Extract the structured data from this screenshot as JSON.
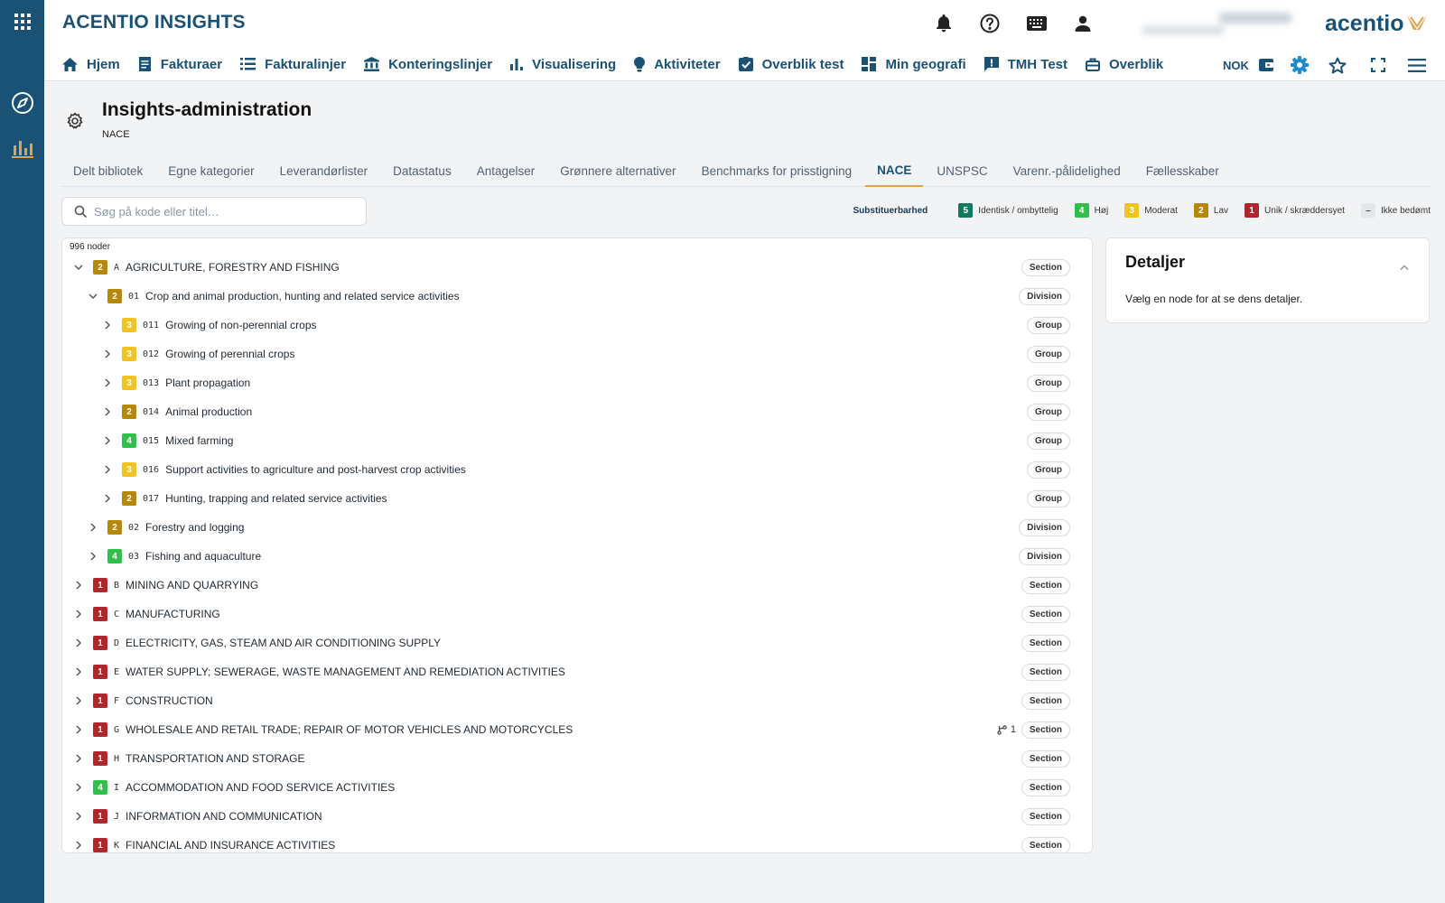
{
  "app": {
    "title": "ACENTIO INSIGHTS",
    "logo_text": "acentio"
  },
  "header": {
    "currency": "NOK"
  },
  "nav": [
    {
      "label": "Hjem",
      "icon": "home-icon"
    },
    {
      "label": "Fakturaer",
      "icon": "document-icon"
    },
    {
      "label": "Fakturalinjer",
      "icon": "list-icon"
    },
    {
      "label": "Konteringslinjer",
      "icon": "bank-icon"
    },
    {
      "label": "Visualisering",
      "icon": "bar-chart-icon"
    },
    {
      "label": "Aktiviteter",
      "icon": "lightbulb-icon"
    },
    {
      "label": "Overblik test",
      "icon": "checkbox-icon"
    },
    {
      "label": "Min geografi",
      "icon": "dashboard-icon"
    },
    {
      "label": "TMH Test",
      "icon": "feedback-icon"
    },
    {
      "label": "Overblik",
      "icon": "briefcase-icon"
    }
  ],
  "page": {
    "title": "Insights-administration",
    "subtitle": "NACE"
  },
  "tabs": [
    {
      "label": "Delt bibliotek"
    },
    {
      "label": "Egne kategorier"
    },
    {
      "label": "Leverandørlister"
    },
    {
      "label": "Datastatus"
    },
    {
      "label": "Antagelser"
    },
    {
      "label": "Grønnere alternativer"
    },
    {
      "label": "Benchmarks for prisstigning"
    },
    {
      "label": "NACE",
      "active": true
    },
    {
      "label": "UNSPSC"
    },
    {
      "label": "Varenr.-pålidelighed"
    },
    {
      "label": "Fællesskaber"
    }
  ],
  "search": {
    "placeholder": "Søg på kode eller titel…",
    "value": ""
  },
  "legend": {
    "title": "Substituerbarhed",
    "items": [
      {
        "level": "5",
        "label": "Identisk / ombyttelig",
        "color": "#0f7a5e"
      },
      {
        "level": "4",
        "label": "Høj",
        "color": "#2fbf4a"
      },
      {
        "level": "3",
        "label": "Moderat",
        "color": "#f2c423"
      },
      {
        "level": "2",
        "label": "Lav",
        "color": "#b8860b"
      },
      {
        "level": "1",
        "label": "Unik / skræddersyet",
        "color": "#b0242b"
      },
      {
        "level": "–",
        "label": "Ikke bedømt",
        "color": "#e3e6ea"
      }
    ]
  },
  "tree": {
    "count_label": "996 noder",
    "rows": [
      {
        "depth": 0,
        "expanded": true,
        "level": "2",
        "code": "A",
        "label": "AGRICULTURE, FORESTRY AND FISHING",
        "type": "Section"
      },
      {
        "depth": 1,
        "expanded": true,
        "level": "2",
        "code": "01",
        "label": "Crop and animal production, hunting and related service activities",
        "type": "Division"
      },
      {
        "depth": 2,
        "expanded": false,
        "level": "3",
        "code": "011",
        "label": "Growing of non-perennial crops",
        "type": "Group"
      },
      {
        "depth": 2,
        "expanded": false,
        "level": "3",
        "code": "012",
        "label": "Growing of perennial crops",
        "type": "Group"
      },
      {
        "depth": 2,
        "expanded": false,
        "level": "3",
        "code": "013",
        "label": "Plant propagation",
        "type": "Group"
      },
      {
        "depth": 2,
        "expanded": false,
        "level": "2",
        "code": "014",
        "label": "Animal production",
        "type": "Group"
      },
      {
        "depth": 2,
        "expanded": false,
        "level": "4",
        "code": "015",
        "label": "Mixed farming",
        "type": "Group"
      },
      {
        "depth": 2,
        "expanded": false,
        "level": "3",
        "code": "016",
        "label": "Support activities to agriculture and post-harvest crop activities",
        "type": "Group"
      },
      {
        "depth": 2,
        "expanded": false,
        "level": "2",
        "code": "017",
        "label": "Hunting, trapping and related service activities",
        "type": "Group"
      },
      {
        "depth": 1,
        "expanded": false,
        "level": "2",
        "code": "02",
        "label": "Forestry and logging",
        "type": "Division"
      },
      {
        "depth": 1,
        "expanded": false,
        "level": "4",
        "code": "03",
        "label": "Fishing and aquaculture",
        "type": "Division"
      },
      {
        "depth": 0,
        "expanded": false,
        "level": "1",
        "code": "B",
        "label": "MINING AND QUARRYING",
        "type": "Section"
      },
      {
        "depth": 0,
        "expanded": false,
        "level": "1",
        "code": "C",
        "label": "MANUFACTURING",
        "type": "Section"
      },
      {
        "depth": 0,
        "expanded": false,
        "level": "1",
        "code": "D",
        "label": "ELECTRICITY, GAS, STEAM AND AIR CONDITIONING SUPPLY",
        "type": "Section"
      },
      {
        "depth": 0,
        "expanded": false,
        "level": "1",
        "code": "E",
        "label": "WATER SUPPLY; SEWERAGE, WASTE MANAGEMENT AND REMEDIATION ACTIVITIES",
        "type": "Section"
      },
      {
        "depth": 0,
        "expanded": false,
        "level": "1",
        "code": "F",
        "label": "CONSTRUCTION",
        "type": "Section"
      },
      {
        "depth": 0,
        "expanded": false,
        "level": "1",
        "code": "G",
        "label": "WHOLESALE AND RETAIL TRADE; REPAIR OF MOTOR VEHICLES AND MOTORCYCLES",
        "type": "Section",
        "relations": "1"
      },
      {
        "depth": 0,
        "expanded": false,
        "level": "1",
        "code": "H",
        "label": "TRANSPORTATION AND STORAGE",
        "type": "Section"
      },
      {
        "depth": 0,
        "expanded": false,
        "level": "4",
        "code": "I",
        "label": "ACCOMMODATION AND FOOD SERVICE ACTIVITIES",
        "type": "Section"
      },
      {
        "depth": 0,
        "expanded": false,
        "level": "1",
        "code": "J",
        "label": "INFORMATION AND COMMUNICATION",
        "type": "Section"
      },
      {
        "depth": 0,
        "expanded": false,
        "level": "1",
        "code": "K",
        "label": "FINANCIAL AND INSURANCE ACTIVITIES",
        "type": "Section"
      }
    ]
  },
  "details": {
    "title": "Detaljer",
    "empty_text": "Vælg en node for at se dens detaljer."
  }
}
